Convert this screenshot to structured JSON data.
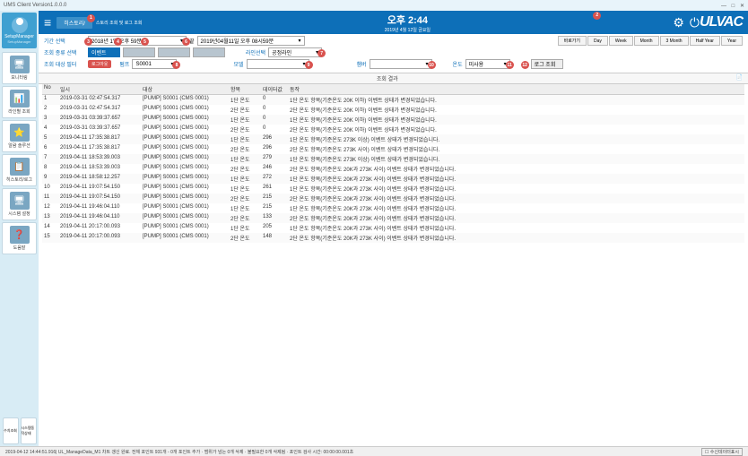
{
  "titlebar": {
    "title": "UMS Client Version1.0.0.0"
  },
  "sidebar": {
    "setup": {
      "name": "SetupManager",
      "sub": "SetupManager"
    },
    "items": [
      {
        "label": "모니터링"
      },
      {
        "label": "라인별 조회"
      },
      {
        "label": "알람 솔루션"
      },
      {
        "label": "히스토리/로그"
      },
      {
        "label": "시스템 설정"
      },
      {
        "label": "도움말"
      }
    ],
    "bottom": [
      {
        "label": "수치조회"
      },
      {
        "label": "시스템동작상태"
      }
    ]
  },
  "topbar": {
    "tab_history": "히스토리/",
    "tab_sub": "스토리 조회 및 로그 조회",
    "clock": "오후 2:44",
    "date": "2019년 4월 12일 금요일",
    "brand": "ULVAC"
  },
  "badges": {
    "b1": "1",
    "b2": "2",
    "b3": "3",
    "b4": "4",
    "b5": "5",
    "b6": "6",
    "b7": "7",
    "b8": "8",
    "b9": "9",
    "b10": "10",
    "b11": "11",
    "b12": "12"
  },
  "filters": {
    "period_label": "기간 선택",
    "date_from": "2018년    1일 오후   59분",
    "date_to_label": "끝",
    "date_to": "2019년04월11일 오후 08시59분",
    "quick_label": "바로가기",
    "quick": [
      "Day",
      "Week",
      "Month",
      "3 Month",
      "Half Year",
      "Year"
    ],
    "type_label": "조회 종류 선택",
    "tabs": [
      "이벤트",
      " ",
      " ",
      " "
    ],
    "line_label": "라인선택",
    "line_value": "공정라인",
    "target_label": "조회 대상 필터",
    "logout": "로그아웃",
    "pump_label": "펌프",
    "pump_value": "S0001",
    "model_label": "모델",
    "model_value": "",
    "chamber_label": "챔버",
    "chamber_value": "",
    "temp_label": "온도",
    "temp_value": "미사용",
    "search_btn": "로그 조회",
    "result_header": "조회 결과"
  },
  "columns": {
    "no": "No",
    "datetime": "일시",
    "target": "대상",
    "item": "항목",
    "dataval": "데이터값",
    "action": "동작"
  },
  "rows": [
    {
      "no": "1",
      "dt": "2019-03-31 02:47:54.317",
      "tg": "[PUMP] S0001 (CMS 0001)",
      "it": "1단 온도",
      "dv": "0",
      "ac": "1단 온도 항목(기준온도 20K 이하) 이벤트 상태가 변경되었습니다."
    },
    {
      "no": "2",
      "dt": "2019-03-31 02:47:54.317",
      "tg": "[PUMP] S0001 (CMS 0001)",
      "it": "2단 온도",
      "dv": "0",
      "ac": "2단 온도 항목(기준온도 20K 이하) 이벤트 상태가 변경되었습니다."
    },
    {
      "no": "3",
      "dt": "2019-03-31 03:39:37.657",
      "tg": "[PUMP] S0001 (CMS 0001)",
      "it": "1단 온도",
      "dv": "0",
      "ac": "1단 온도 항목(기준온도 20K 이하) 이벤트 상태가 변경되었습니다."
    },
    {
      "no": "4",
      "dt": "2019-03-31 03:39:37.657",
      "tg": "[PUMP] S0001 (CMS 0001)",
      "it": "2단 온도",
      "dv": "0",
      "ac": "2단 온도 항목(기준온도 20K 이하) 이벤트 상태가 변경되었습니다."
    },
    {
      "no": "5",
      "dt": "2019-04-11 17:35:38.817",
      "tg": "[PUMP] S0001 (CMS 0001)",
      "it": "1단 온도",
      "dv": "296",
      "ac": "1단 온도 항목(기준온도 273K 이상) 이벤트 상태가 변경되었습니다."
    },
    {
      "no": "6",
      "dt": "2019-04-11 17:35:38.817",
      "tg": "[PUMP] S0001 (CMS 0001)",
      "it": "2단 온도",
      "dv": "296",
      "ac": "2단 온도 항목(기준온도 273K 사이) 이벤트 상태가 변경되었습니다."
    },
    {
      "no": "7",
      "dt": "2019-04-11 18:53:39.003",
      "tg": "[PUMP] S0001 (CMS 0001)",
      "it": "1단 온도",
      "dv": "279",
      "ac": "1단 온도 항목(기준온도 273K 이상) 이벤트 상태가 변경되었습니다."
    },
    {
      "no": "8",
      "dt": "2019-04-11 18:53:39.003",
      "tg": "[PUMP] S0001 (CMS 0001)",
      "it": "2단 온도",
      "dv": "246",
      "ac": "2단 온도 항목(기준온도 20K과 273K 사이) 이벤트 상태가 변경되었습니다."
    },
    {
      "no": "9",
      "dt": "2019-04-11 18:58:12.257",
      "tg": "[PUMP] S0001 (CMS 0001)",
      "it": "1단 온도",
      "dv": "272",
      "ac": "1단 온도 항목(기준온도 20K과 273K 사이) 이벤트 상태가 변경되었습니다."
    },
    {
      "no": "10",
      "dt": "2019-04-11 19:07:54.150",
      "tg": "[PUMP] S0001 (CMS 0001)",
      "it": "1단 온도",
      "dv": "261",
      "ac": "1단 온도 항목(기준온도 20K과 273K 사이) 이벤트 상태가 변경되었습니다."
    },
    {
      "no": "11",
      "dt": "2019-04-11 19:07:54.150",
      "tg": "[PUMP] S0001 (CMS 0001)",
      "it": "2단 온도",
      "dv": "215",
      "ac": "2단 온도 항목(기준온도 20K과 273K 사이) 이벤트 상태가 변경되었습니다."
    },
    {
      "no": "12",
      "dt": "2019-04-11 19:46:04.110",
      "tg": "[PUMP] S0001 (CMS 0001)",
      "it": "1단 온도",
      "dv": "215",
      "ac": "1단 온도 항목(기준온도 20K과 273K 사이) 이벤트 상태가 변경되었습니다."
    },
    {
      "no": "13",
      "dt": "2019-04-11 19:46:04.110",
      "tg": "[PUMP] S0001 (CMS 0001)",
      "it": "2단 온도",
      "dv": "133",
      "ac": "2단 온도 항목(기준온도 20K과 273K 사이) 이벤트 상태가 변경되었습니다."
    },
    {
      "no": "14",
      "dt": "2019-04-11 20:17:00.093",
      "tg": "[PUMP] S0001 (CMS 0001)",
      "it": "1단 온도",
      "dv": "205",
      "ac": "1단 온도 항목(기준온도 20K과 273K 사이) 이벤트 상태가 변경되었습니다."
    },
    {
      "no": "15",
      "dt": "2019-04-11 20:17:00.093",
      "tg": "[PUMP] S0001 (CMS 0001)",
      "it": "2단 온도",
      "dv": "148",
      "ac": "2단 온도 항목(기준온도 20K과 273K 사이) 이벤트 상태가 변경되었습니다."
    }
  ],
  "statusbar": {
    "msg": "2019-04-12 14:44:51.916| UL_ManageData_M1 차트 갱신 완료. 전체 포인트 931개 - 0개 포인트 추가 · 범위가 넘는 0개 삭제 · 불필요한 0개 삭제됨 · 포인트 검사 시간: 00:00:00.001초",
    "rx": "수신데이터표시"
  }
}
